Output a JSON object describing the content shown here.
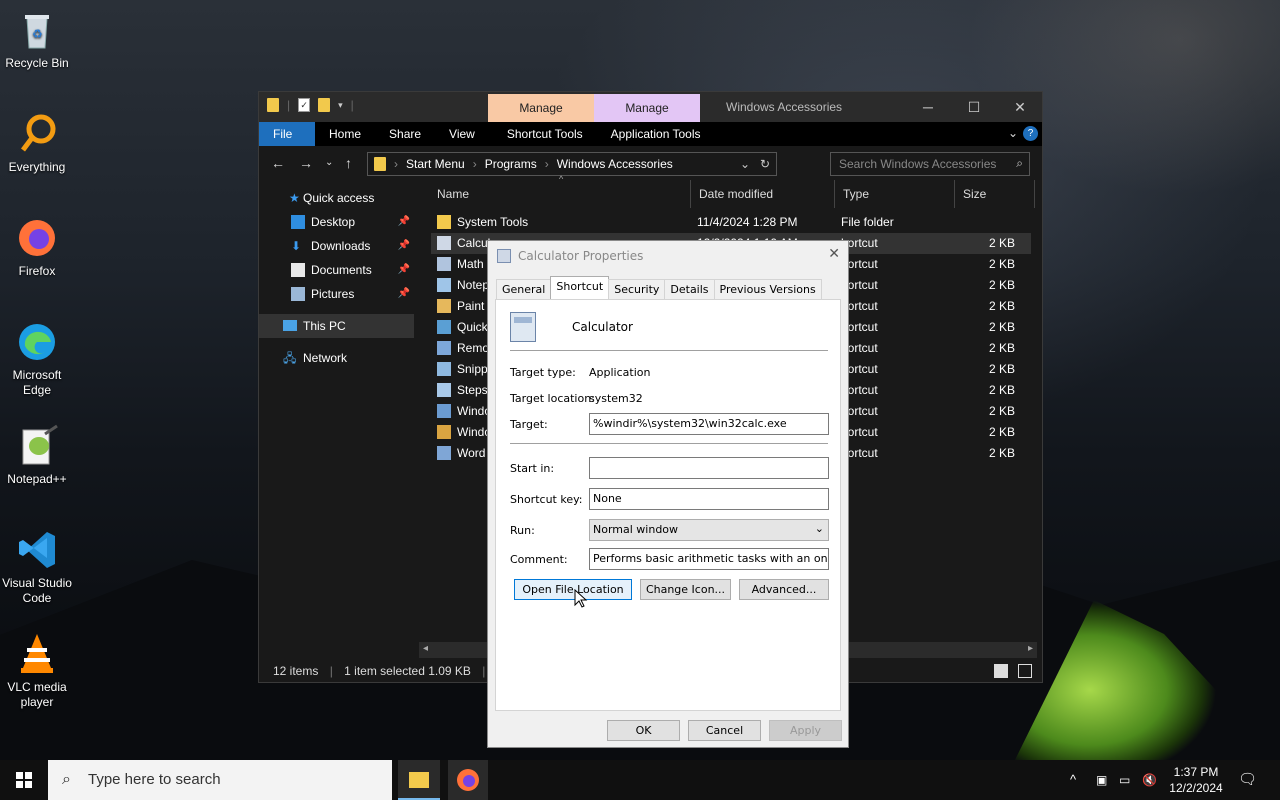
{
  "desktop_icons": [
    {
      "label": "Recycle Bin",
      "icon": "recycle-bin-icon"
    },
    {
      "label": "Everything",
      "icon": "everything-icon"
    },
    {
      "label": "Firefox",
      "icon": "firefox-icon"
    },
    {
      "label": "Microsoft Edge",
      "icon": "edge-icon"
    },
    {
      "label": "Notepad++",
      "icon": "notepadpp-icon"
    },
    {
      "label": "Visual Studio Code",
      "icon": "vscode-icon"
    },
    {
      "label": "VLC media player",
      "icon": "vlc-icon"
    }
  ],
  "explorer": {
    "title": "Windows Accessories",
    "manage1": "Manage",
    "manage2": "Manage",
    "ribbon_tabs": [
      "File",
      "Home",
      "Share",
      "View",
      "Shortcut Tools",
      "Application Tools"
    ],
    "breadcrumb": [
      "Start Menu",
      "Programs",
      "Windows Accessories"
    ],
    "search_placeholder": "Search Windows Accessories",
    "sidebar": [
      {
        "label": "Quick access",
        "pinned": false
      },
      {
        "label": "Desktop",
        "pinned": true
      },
      {
        "label": "Downloads",
        "pinned": true
      },
      {
        "label": "Documents",
        "pinned": true
      },
      {
        "label": "Pictures",
        "pinned": true
      },
      {
        "label": "This PC",
        "pinned": false
      },
      {
        "label": "Network",
        "pinned": false
      }
    ],
    "columns": {
      "name": "Name",
      "date": "Date modified",
      "type": "Type",
      "size": "Size"
    },
    "rows": [
      {
        "name": "System Tools",
        "date": "11/4/2024 1:28 PM",
        "type": "File folder",
        "size": ""
      },
      {
        "name": "Calcul",
        "date": "12/2/2024 1:10 AM",
        "type": "hortcut",
        "size": "2 KB"
      },
      {
        "name": "Math",
        "date": "",
        "type": "hortcut",
        "size": "2 KB"
      },
      {
        "name": "Notep",
        "date": "",
        "type": "hortcut",
        "size": "2 KB"
      },
      {
        "name": "Paint",
        "date": "",
        "type": "hortcut",
        "size": "2 KB"
      },
      {
        "name": "Quick",
        "date": "",
        "type": "hortcut",
        "size": "2 KB"
      },
      {
        "name": "Remo",
        "date": "",
        "type": "hortcut",
        "size": "2 KB"
      },
      {
        "name": "Snipp",
        "date": "",
        "type": "hortcut",
        "size": "2 KB"
      },
      {
        "name": "Steps",
        "date": "",
        "type": "hortcut",
        "size": "2 KB"
      },
      {
        "name": "Windo",
        "date": "",
        "type": "hortcut",
        "size": "2 KB"
      },
      {
        "name": "Windo",
        "date": "",
        "type": "hortcut",
        "size": "2 KB"
      },
      {
        "name": "Word",
        "date": "",
        "type": "hortcut",
        "size": "2 KB"
      }
    ],
    "status_items": "12 items",
    "status_selected": "1 item selected  1.09 KB"
  },
  "dialog": {
    "title": "Calculator Properties",
    "tabs": [
      "General",
      "Shortcut",
      "Security",
      "Details",
      "Previous Versions"
    ],
    "app_name": "Calculator",
    "target_type_label": "Target type:",
    "target_type": "Application",
    "target_location_label": "Target location:",
    "target_location": "system32",
    "target_label": "Target:",
    "target": "%windir%\\system32\\win32calc.exe",
    "start_in_label": "Start in:",
    "start_in": "",
    "shortcut_key_label": "Shortcut key:",
    "shortcut_key": "None",
    "run_label": "Run:",
    "run": "Normal window",
    "comment_label": "Comment:",
    "comment": "Performs basic arithmetic tasks with an on-screen",
    "open_location": "Open File Location",
    "change_icon": "Change Icon...",
    "advanced": "Advanced...",
    "ok": "OK",
    "cancel": "Cancel",
    "apply": "Apply"
  },
  "taskbar": {
    "search_placeholder": "Type here to search",
    "time": "1:37 PM",
    "date": "12/2/2024"
  }
}
